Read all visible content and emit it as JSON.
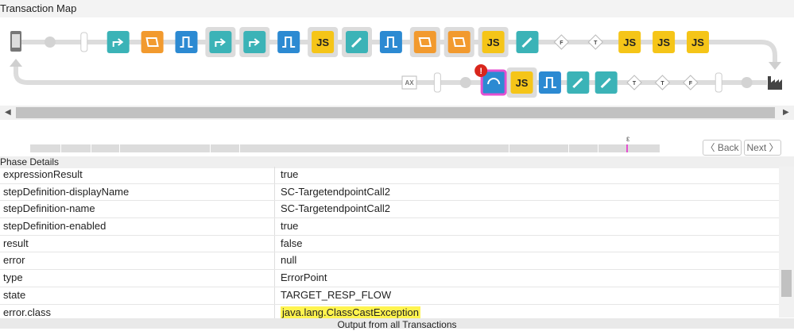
{
  "header": {
    "title": "Transaction Map"
  },
  "map": {
    "top_row": [
      {
        "type": "phone",
        "icon": "phone-icon"
      },
      {
        "type": "dot"
      },
      {
        "type": "bar"
      },
      {
        "type": "step",
        "color": "#3bb3b7",
        "icon": "share-icon"
      },
      {
        "type": "step",
        "color": "#f29a2e",
        "icon": "scroll-icon"
      },
      {
        "type": "step",
        "color": "#2c8ad2",
        "icon": "flow-icon"
      },
      {
        "type": "step",
        "color": "#3bb3b7",
        "icon": "share-icon",
        "group": true
      },
      {
        "type": "step",
        "color": "#3bb3b7",
        "icon": "share-icon",
        "group": true
      },
      {
        "type": "step",
        "color": "#2c8ad2",
        "icon": "flow-icon"
      },
      {
        "type": "step",
        "color": "#f5c518",
        "icon": "js-icon",
        "label": "JS",
        "group": true
      },
      {
        "type": "step",
        "color": "#3bb3b7",
        "icon": "pencil-icon",
        "group": true
      },
      {
        "type": "step",
        "color": "#2c8ad2",
        "icon": "flow-icon"
      },
      {
        "type": "step",
        "color": "#f29a2e",
        "icon": "scroll-icon",
        "group": true
      },
      {
        "type": "step",
        "color": "#f29a2e",
        "icon": "scroll-icon",
        "group": true
      },
      {
        "type": "step",
        "color": "#f5c518",
        "icon": "js-icon",
        "label": "JS",
        "group": true
      },
      {
        "type": "step",
        "color": "#3bb3b7",
        "icon": "pencil-icon"
      },
      {
        "type": "diamond",
        "label": "F"
      },
      {
        "type": "diamond",
        "label": "T"
      },
      {
        "type": "step",
        "color": "#f5c518",
        "icon": "js-icon",
        "label": "JS"
      },
      {
        "type": "step",
        "color": "#f5c518",
        "icon": "js-icon",
        "label": "JS"
      },
      {
        "type": "step",
        "color": "#f5c518",
        "icon": "js-icon",
        "label": "JS"
      }
    ],
    "bottom_row": [
      {
        "type": "box",
        "label": "AX"
      },
      {
        "type": "bar"
      },
      {
        "type": "dot"
      },
      {
        "type": "error-step",
        "color": "#2c8ad2",
        "icon": "refresh-icon",
        "badge": "!"
      },
      {
        "type": "step",
        "color": "#f5c518",
        "icon": "js-icon",
        "label": "JS",
        "group": true
      },
      {
        "type": "step",
        "color": "#2c8ad2",
        "icon": "flow-icon"
      },
      {
        "type": "step",
        "color": "#3bb3b7",
        "icon": "pencil-icon"
      },
      {
        "type": "step",
        "color": "#3bb3b7",
        "icon": "pencil-icon"
      },
      {
        "type": "diamond",
        "label": "T"
      },
      {
        "type": "diamond",
        "label": "T"
      },
      {
        "type": "diamond",
        "label": "F"
      },
      {
        "type": "bar"
      },
      {
        "type": "dot"
      },
      {
        "type": "factory",
        "icon": "factory-icon"
      }
    ]
  },
  "timeline": {
    "marker": "ε"
  },
  "nav": {
    "back_label": "〈 Back",
    "next_label": "Next 〉"
  },
  "phase": {
    "title": "Phase Details"
  },
  "rows": [
    {
      "key": "expressionResult",
      "value": "true"
    },
    {
      "key": "stepDefinition-displayName",
      "value": "SC-TargetendpointCall2"
    },
    {
      "key": "stepDefinition-name",
      "value": "SC-TargetendpointCall2"
    },
    {
      "key": "stepDefinition-enabled",
      "value": "true"
    },
    {
      "key": "result",
      "value": "false"
    },
    {
      "key": "error",
      "value": "null"
    },
    {
      "key": "type",
      "value": "ErrorPoint"
    },
    {
      "key": "state",
      "value": "TARGET_RESP_FLOW"
    },
    {
      "key": "error.class",
      "value": "java.lang.ClassCastException",
      "highlight": true
    }
  ],
  "footer": {
    "label": "Output from all Transactions"
  },
  "colors": {
    "teal": "#3bb3b7",
    "orange": "#f29a2e",
    "blue": "#2c8ad2",
    "yellow": "#f5c518",
    "error_border": "#e44fd0"
  }
}
